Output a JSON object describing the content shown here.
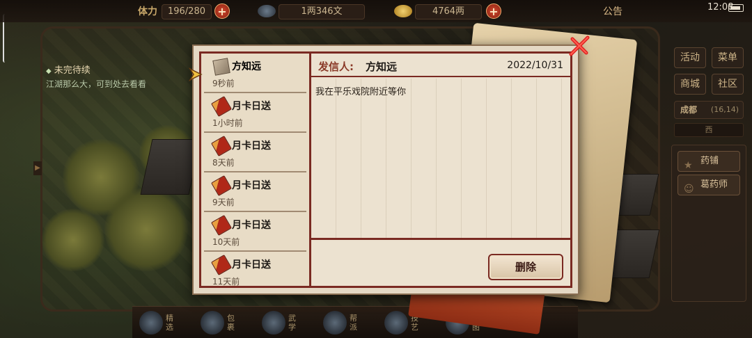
{
  "topbar": {
    "stamina_label": "体力",
    "stamina_value": "196/280",
    "copper_value": "1两346文",
    "silver_value": "4764两",
    "notice_label": "公告",
    "clock": "12:08"
  },
  "quest": {
    "title": "未完待续",
    "description": "江湖那么大，可到处去看看"
  },
  "right_menu": {
    "activity": "活动",
    "menu": "菜单",
    "shop": "商城",
    "community": "社区",
    "location_name": "成都",
    "location_coords": "(16,14)",
    "compass": "西",
    "npc_items": [
      {
        "label": "药铺",
        "icon": "star-icon"
      },
      {
        "label": "葛药师",
        "icon": "person-icon"
      }
    ]
  },
  "bottom_bar": {
    "items": [
      {
        "label": "精选"
      },
      {
        "label": "包裹"
      },
      {
        "label": "武学"
      },
      {
        "label": "帮派"
      },
      {
        "label": "技艺"
      },
      {
        "label": "地图"
      }
    ]
  },
  "mail": {
    "items": [
      {
        "sender": "方知远",
        "time": "9秒前",
        "icon": "scroll-icon",
        "selected": true
      },
      {
        "sender": "月卡日送",
        "time": "1小时前",
        "icon": "card-icon"
      },
      {
        "sender": "月卡日送",
        "time": "8天前",
        "icon": "card-icon"
      },
      {
        "sender": "月卡日送",
        "time": "9天前",
        "icon": "card-icon"
      },
      {
        "sender": "月卡日送",
        "time": "10天前",
        "icon": "card-icon"
      },
      {
        "sender": "月卡日送",
        "time": "11天前",
        "icon": "card-icon"
      }
    ],
    "view": {
      "sender_label": "发信人:",
      "sender": "方知远",
      "date": "2022/10/31",
      "body": "我在平乐戏院附近等你",
      "delete_label": "删除"
    }
  },
  "colors": {
    "accent_red": "#7a2a22",
    "parchment": "#ece2d0",
    "plus_button": "#c0401f"
  }
}
